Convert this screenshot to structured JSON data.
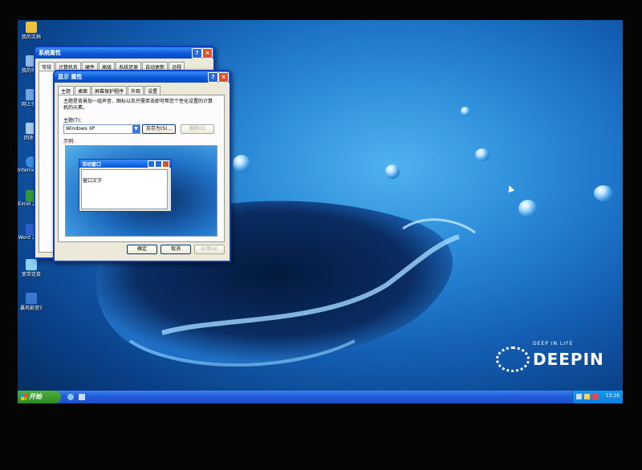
{
  "desktop": {
    "icons": [
      {
        "label": "我的文档",
        "color": "#f0c040"
      },
      {
        "label": "我的电脑",
        "color": "#8fb8e8"
      },
      {
        "label": "网上邻居",
        "color": "#6fa6e0"
      },
      {
        "label": "回收站",
        "color": "#a8c8e8"
      },
      {
        "label": "Internet Explorer",
        "color": "#3b8de0"
      },
      {
        "label": "Excel 2003",
        "color": "#2f9a3c"
      },
      {
        "label": "Word 2003",
        "color": "#2d5ec8"
      },
      {
        "label": "宽带连接",
        "color": "#8ad0f0"
      },
      {
        "label": "暴风影音5",
        "color": "#3a78d0"
      }
    ],
    "brand_small": "DEEP IN LIFE",
    "brand_big": "DEEPIN"
  },
  "sys_window": {
    "title": "系统属性",
    "tabs": [
      "常规",
      "计算机名",
      "硬件",
      "高级",
      "系统还原",
      "自动更新",
      "远程"
    ]
  },
  "display_window": {
    "title": "显示 属性",
    "tabs": [
      "主题",
      "桌面",
      "屏幕保护程序",
      "外观",
      "设置"
    ],
    "description": "主题是背景加一组声音、图标以及只需单击即可帮您个性化设置的计算机的元素。",
    "theme_label": "主题(T):",
    "theme_value": "Windows XP",
    "save_as": "另存为(S)...",
    "delete": "删除(E)",
    "sample_label": "示例:",
    "preview_window_title": "活动窗口",
    "preview_text": "窗口文字",
    "ok": "确定",
    "cancel": "取消",
    "apply": "应用(A)"
  },
  "taskbar": {
    "start": "开始",
    "clock": "13:16"
  }
}
